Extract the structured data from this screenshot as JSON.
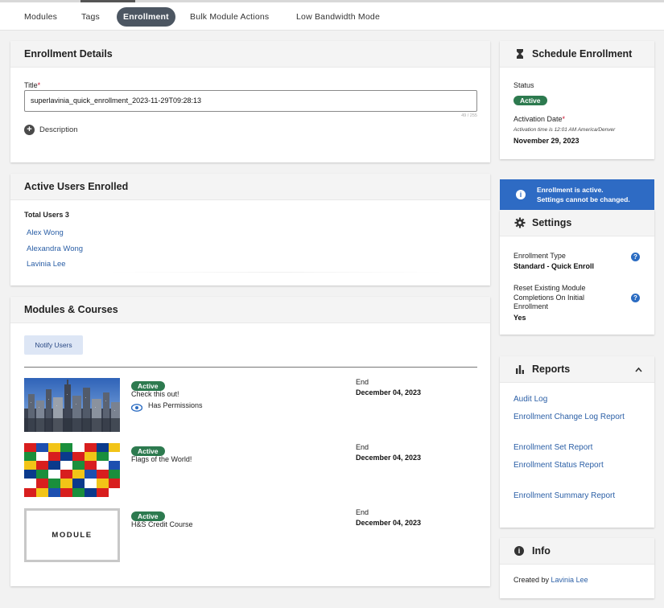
{
  "nav": {
    "tabs": [
      {
        "label": "Modules"
      },
      {
        "label": "Tags"
      },
      {
        "label": "Enrollment"
      },
      {
        "label": "Bulk Module Actions"
      },
      {
        "label": "Low Bandwidth Mode"
      }
    ],
    "active_tab": "Enrollment"
  },
  "enrollment_details": {
    "heading": "Enrollment Details",
    "title_label": "Title",
    "required_mark": "*",
    "title_value": "superlavinia_quick_enrollment_2023-11-29T09:28:13",
    "char_counter": "49 / 255",
    "description_label": "Description"
  },
  "active_users": {
    "heading": "Active Users Enrolled",
    "total_label": "Total Users 3",
    "users": [
      {
        "name": "Alex Wong"
      },
      {
        "name": "Alexandra Wong"
      },
      {
        "name": "Lavinia Lee"
      }
    ]
  },
  "modules": {
    "heading": "Modules & Courses",
    "notify_button": "Notify Users",
    "items": [
      {
        "status": "Active",
        "title": "Check this out!",
        "permissions": "Has Permissions",
        "end_label": "End",
        "end_date": "December 04, 2023",
        "thumbnail": "city"
      },
      {
        "status": "Active",
        "title": "Flags of the World!",
        "end_label": "End",
        "end_date": "December 04, 2023",
        "thumbnail": "flags"
      },
      {
        "status": "Active",
        "title": "H&S Credit Course",
        "end_label": "End",
        "end_date": "December 04, 2023",
        "thumbnail": "module",
        "thumbnail_text": "MODULE"
      }
    ]
  },
  "schedule": {
    "heading": "Schedule Enrollment",
    "status_label": "Status",
    "status_value": "Active",
    "activation_label": "Activation Date",
    "required_mark": "*",
    "activation_note": "Activation time is 12:01 AM America/Denver",
    "activation_date": "November 29, 2023"
  },
  "banner": {
    "line1": "Enrollment is active.",
    "line2": "Settings cannot be changed."
  },
  "settings": {
    "heading": "Settings",
    "type_label": "Enrollment Type",
    "type_value": "Standard - Quick Enroll",
    "reset_label": "Reset Existing Module Completions On Initial Enrollment",
    "reset_value": "Yes"
  },
  "reports": {
    "heading": "Reports",
    "links": [
      {
        "label": "Audit Log"
      },
      {
        "label": "Enrollment Change Log Report"
      },
      {
        "label": "Enrollment Set Report"
      },
      {
        "label": "Enrollment Status Report"
      },
      {
        "label": "Enrollment Summary Report"
      }
    ]
  },
  "info": {
    "heading": "Info",
    "created_by_label": "Created by",
    "created_by_name": "Lavinia Lee"
  },
  "colors": {
    "active_badge": "#2d7a4f",
    "link": "#2b5fa6",
    "banner": "#2e6bc4",
    "active_tab": "#4c5662"
  }
}
